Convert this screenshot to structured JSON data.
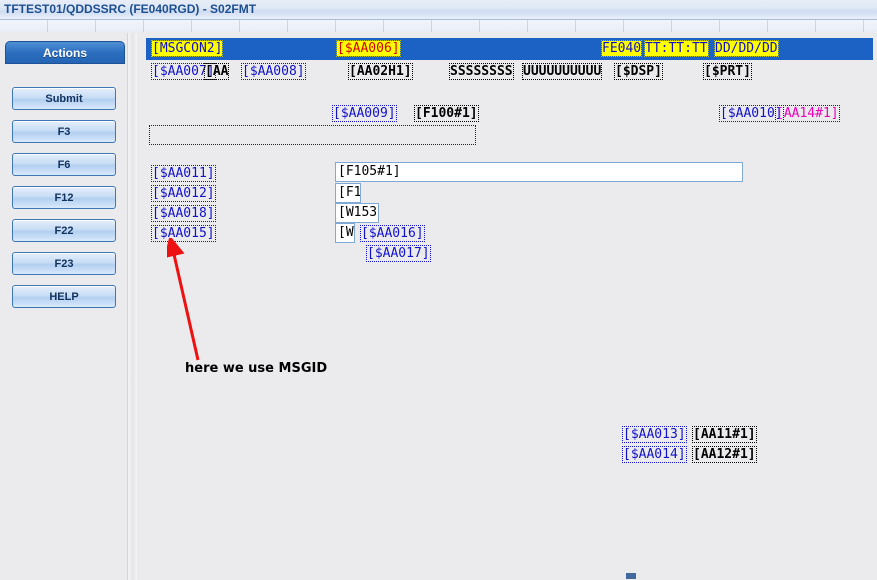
{
  "window": {
    "title": "TFTEST01/QDDSSRC (FE040RGD) - S02FMT"
  },
  "sidebar": {
    "header": "Actions",
    "buttons": [
      {
        "label": "Submit"
      },
      {
        "label": "F3"
      },
      {
        "label": "F6"
      },
      {
        "label": "F12"
      },
      {
        "label": "F22"
      },
      {
        "label": "F23"
      },
      {
        "label": "HELP"
      }
    ]
  },
  "screen": {
    "header_row": [
      {
        "text": "[MSGCON2]",
        "color": "#1111cc",
        "bg": "#ffff00"
      },
      {
        "text": "[$AA006]",
        "color": "#d40000",
        "bg": "#ffff00"
      },
      {
        "text": "FE040",
        "color": "#1111cc",
        "bg": "#ffff00"
      },
      {
        "text": "TT:TT:TT",
        "color": "#1111cc",
        "bg": "#ffff00"
      },
      {
        "text": "DD/DD/DD",
        "color": "#1111cc",
        "bg": "#ffff00"
      }
    ],
    "second_row": [
      {
        "text": "[$AA007]",
        "color": "#1111cc"
      },
      {
        "text": "[AA",
        "color": "#000000"
      },
      {
        "text": "[$AA008]",
        "color": "#1111cc"
      },
      {
        "text": "[AA02H1]",
        "color": "#000000"
      },
      {
        "text": "SSSSSSSS",
        "color": "#000000"
      },
      {
        "text": "UUUUUUUUUU",
        "color": "#000000"
      },
      {
        "text": "[$DSP]",
        "color": "#000000"
      },
      {
        "text": "[$PRT]",
        "color": "#000000"
      }
    ],
    "third_row": [
      {
        "text": "[$AA009]",
        "color": "#1111cc"
      },
      {
        "text": "[F100#1]",
        "color": "#000000"
      },
      {
        "text": "[$AA010]",
        "color": "#1111cc"
      },
      {
        "text": "[AA14#1]",
        "color": "#ee00bb"
      }
    ],
    "left_labels": [
      {
        "text": "[$AA011]",
        "color": "#1111cc"
      },
      {
        "text": "[$AA012]",
        "color": "#1111cc"
      },
      {
        "text": "[$AA018]",
        "color": "#1111cc"
      },
      {
        "text": "[$AA015]",
        "color": "#1111cc"
      }
    ],
    "entry_fields": [
      {
        "value": "[F105#1]"
      },
      {
        "value": "[F1"
      },
      {
        "value": "[W153"
      },
      {
        "value": "[W"
      }
    ],
    "nested_labels": [
      {
        "text": "[$AA016]",
        "color": "#1111cc"
      },
      {
        "text": "[$AA017]",
        "color": "#1111cc"
      }
    ],
    "bottom_right": [
      {
        "label": "[$AA013]",
        "value": "[AA11#1]"
      },
      {
        "label": "[$AA014]",
        "value": "[AA12#1]"
      }
    ],
    "annotation": {
      "text": "here we use MSGID",
      "arrow_color": "#ee1111"
    }
  }
}
